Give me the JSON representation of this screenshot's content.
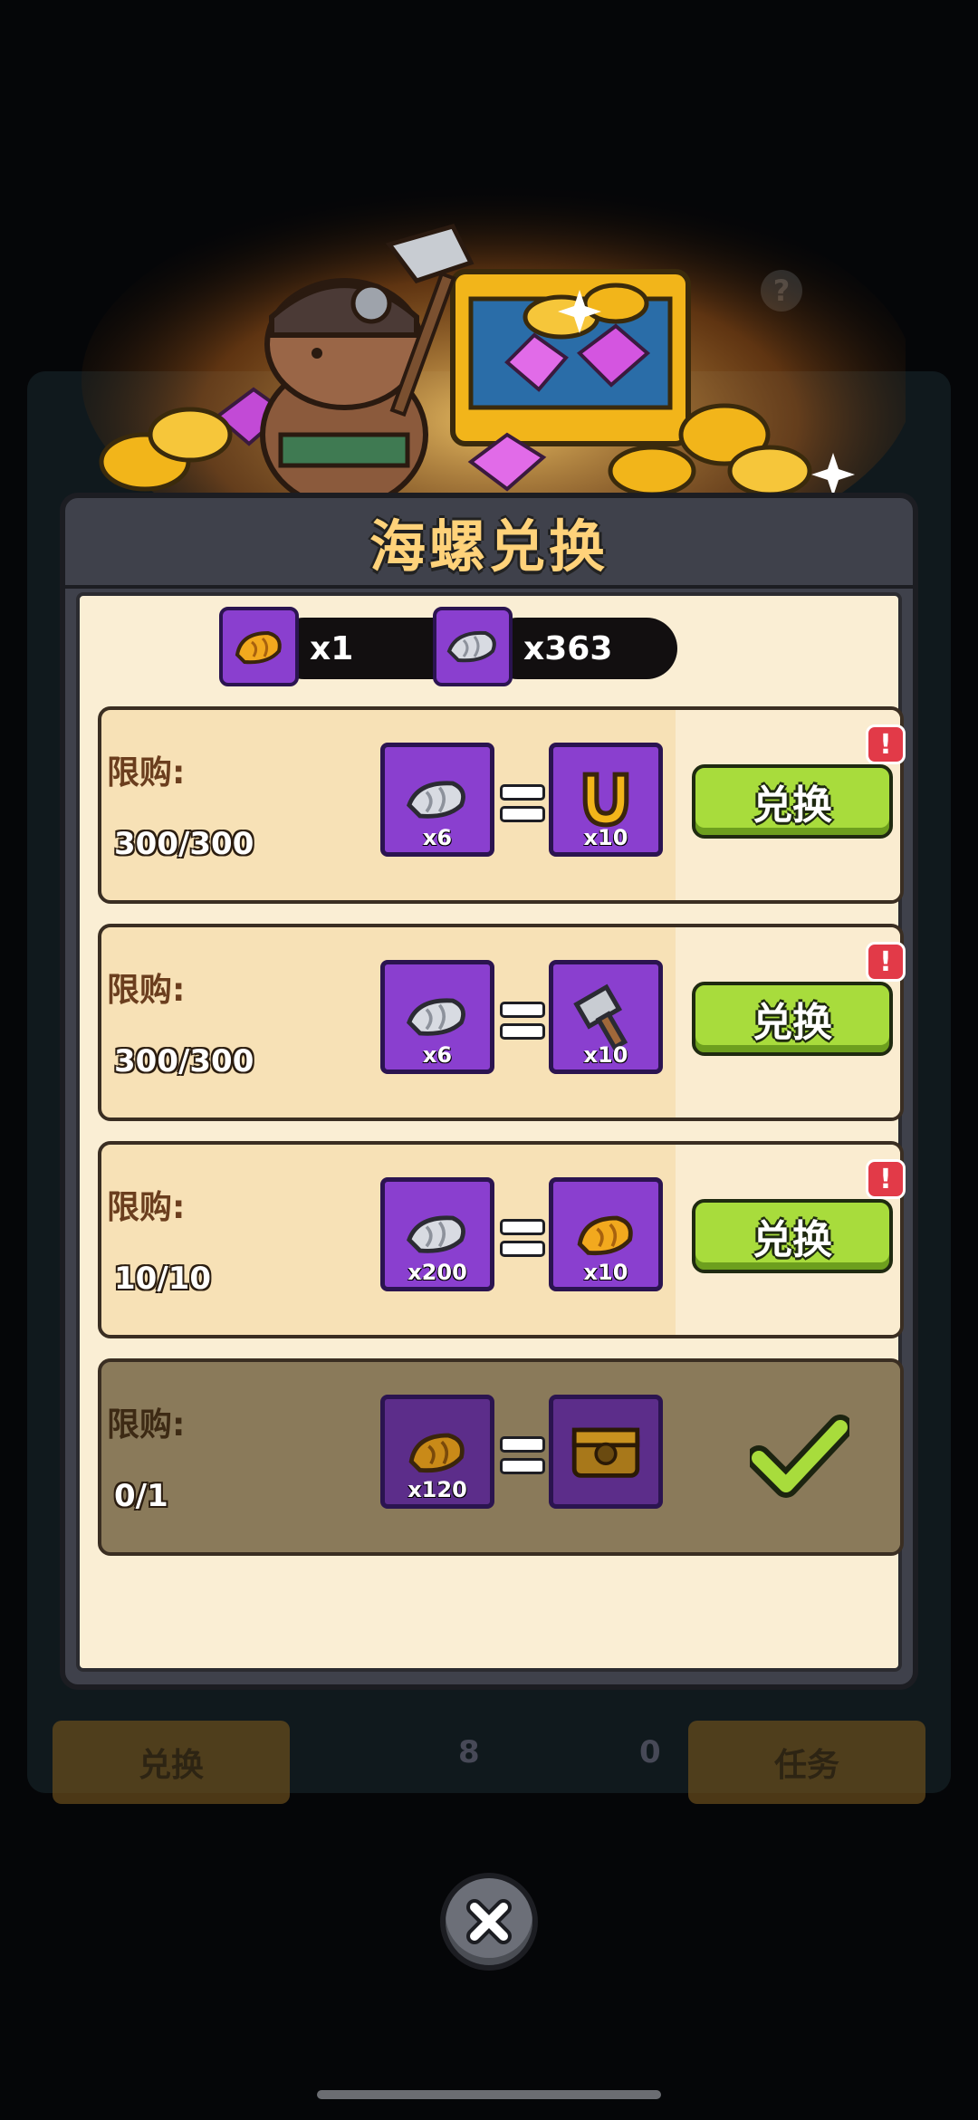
{
  "background": {
    "left_button": "兑换",
    "right_button": "任务",
    "count_a": "8",
    "count_b": "0",
    "help_icon": "question-icon"
  },
  "dialog": {
    "title": "海螺兑换",
    "currencies": [
      {
        "icon": "golden-conch-icon",
        "amount": "x1"
      },
      {
        "icon": "silver-shell-icon",
        "amount": "x363"
      }
    ],
    "rows": [
      {
        "limit_label": "限购:",
        "limit": "300/300",
        "cost_icon": "silver-shell-icon",
        "cost_qty": "x6",
        "reward_icon": "horseshoe-icon",
        "reward_qty": "x10",
        "button": "兑换",
        "alert": "!",
        "claimed": false
      },
      {
        "limit_label": "限购:",
        "limit": "300/300",
        "cost_icon": "silver-shell-icon",
        "cost_qty": "x6",
        "reward_icon": "hammer-icon",
        "reward_qty": "x10",
        "button": "兑换",
        "alert": "!",
        "claimed": false
      },
      {
        "limit_label": "限购:",
        "limit": "10/10",
        "cost_icon": "silver-shell-icon",
        "cost_qty": "x200",
        "reward_icon": "golden-conch-icon",
        "reward_qty": "x10",
        "button": "兑换",
        "alert": "!",
        "claimed": false
      },
      {
        "limit_label": "限购:",
        "limit": "0/1",
        "cost_icon": "golden-conch-icon",
        "cost_qty": "x120",
        "reward_icon": "treasure-chest-icon",
        "reward_qty": "",
        "button": "",
        "alert": "",
        "claimed": true
      }
    ]
  },
  "colors": {
    "accent_purple": "#8a3fcf",
    "button_green": "#a8dc3c",
    "title_gold": "#ffd27a",
    "alert_red": "#e23a48"
  }
}
